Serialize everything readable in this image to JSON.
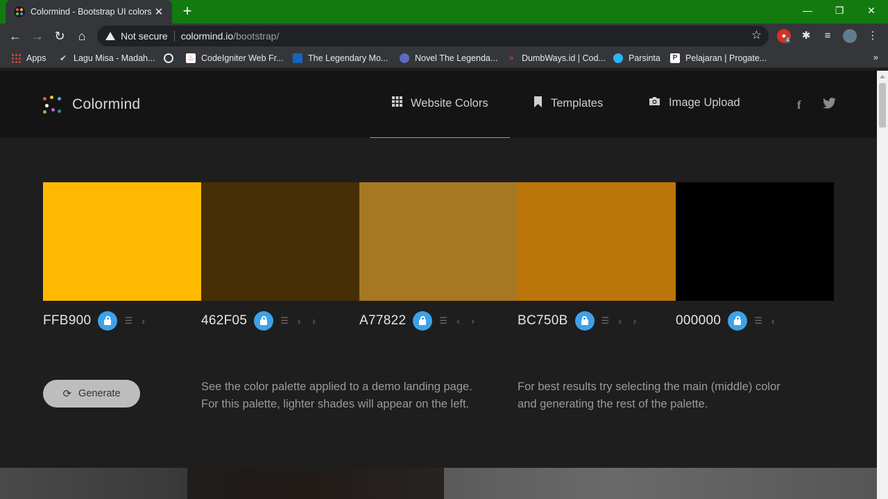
{
  "browser": {
    "tab_title": "Colormind - Bootstrap UI colors",
    "tab_close": "✕",
    "new_tab": "+",
    "window": {
      "minimize": "—",
      "restore": "❐",
      "close": "✕"
    },
    "security_label": "Not secure",
    "url_host": "colormind.io",
    "url_path": "/bootstrap/",
    "extension_badge": "4",
    "bookmarks": [
      {
        "label": "Apps",
        "color": "#e94235"
      },
      {
        "label": "Lagu Misa - Madah...",
        "color": "#cfcfcf"
      },
      {
        "label": "",
        "color": "#e8eaed"
      },
      {
        "label": "CodeIgniter Web Fr...",
        "color": "#ee4323"
      },
      {
        "label": "The Legendary Mo...",
        "color": "#2196f3"
      },
      {
        "label": "Novel The Legenda...",
        "color": "#5c6bc0"
      },
      {
        "label": "DumbWays.id | Cod...",
        "color": "#e53935"
      },
      {
        "label": "Parsinta",
        "color": "#29b6f6"
      },
      {
        "label": "Pelajaran | Progate...",
        "color": "#ffffff"
      }
    ],
    "bookmarks_more": "»"
  },
  "site": {
    "logo": "Colormind",
    "nav": [
      {
        "label": "Website Colors",
        "icon": "grid-icon"
      },
      {
        "label": "Templates",
        "icon": "bookmark-icon"
      },
      {
        "label": "Image Upload",
        "icon": "camera-icon"
      }
    ],
    "social": {
      "facebook": "f",
      "twitter": "🐦"
    }
  },
  "palette": [
    {
      "hex": "FFB900",
      "color": "#ffb900",
      "left_arrow": false,
      "right_arrow": true
    },
    {
      "hex": "462F05",
      "color": "#462f05",
      "left_arrow": true,
      "right_arrow": true
    },
    {
      "hex": "A77822",
      "color": "#a77822",
      "left_arrow": true,
      "right_arrow": true
    },
    {
      "hex": "BC750B",
      "color": "#bc750b",
      "left_arrow": true,
      "right_arrow": true
    },
    {
      "hex": "000000",
      "color": "#000000",
      "left_arrow": true,
      "right_arrow": false
    }
  ],
  "actions": {
    "generate_label": "Generate"
  },
  "descriptions": {
    "demo_line1": "See the color palette applied to a demo landing page.",
    "demo_line2": "For this palette, lighter shades will appear on the left.",
    "tip_line1": "For best results try selecting the main (middle) color",
    "tip_line2": "and generating the rest of the palette."
  },
  "colors": {
    "accent_lock": "#3ea2e8",
    "header_bg": "#141414",
    "page_bg": "#1e1e1e",
    "tab_strip": "#137a10"
  }
}
